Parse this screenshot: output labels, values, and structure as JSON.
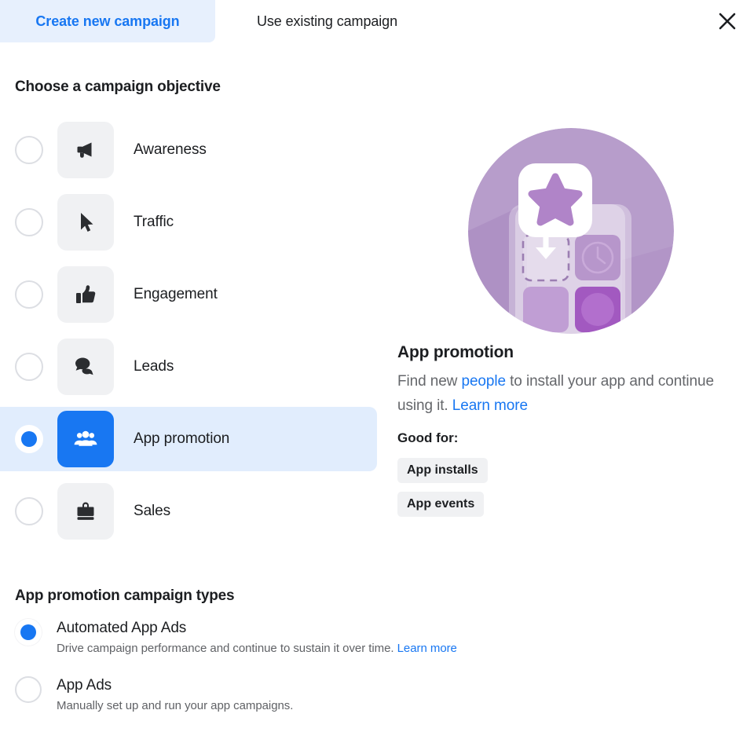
{
  "tabs": [
    {
      "label": "Create new campaign",
      "active": true
    },
    {
      "label": "Use existing campaign",
      "active": false
    }
  ],
  "close_icon": "close-icon",
  "objective_section": {
    "title": "Choose a campaign objective",
    "options": [
      {
        "label": "Awareness",
        "icon": "megaphone-icon",
        "selected": false
      },
      {
        "label": "Traffic",
        "icon": "cursor-icon",
        "selected": false
      },
      {
        "label": "Engagement",
        "icon": "thumbs-up-icon",
        "selected": false
      },
      {
        "label": "Leads",
        "icon": "chat-bubble-icon",
        "selected": false
      },
      {
        "label": "App promotion",
        "icon": "people-icon",
        "selected": true
      },
      {
        "label": "Sales",
        "icon": "briefcase-icon",
        "selected": false
      }
    ]
  },
  "detail": {
    "illustration": "app-install-illustration",
    "title": "App promotion",
    "description_part1": "Find new ",
    "description_link1": "people",
    "description_part2": " to install your app and continue using it. ",
    "description_link2": "Learn more",
    "good_for_label": "Good for:",
    "chips": [
      "App installs",
      "App events"
    ]
  },
  "campaign_types": {
    "title": "App promotion campaign types",
    "options": [
      {
        "label": "Automated App Ads",
        "description": "Drive campaign performance and continue to sustain it over time.",
        "link": "Learn more",
        "selected": true
      },
      {
        "label": "App Ads",
        "description": "Manually set up and run your app campaigns.",
        "link": "",
        "selected": false
      }
    ]
  },
  "colors": {
    "accent_blue": "#1877f2",
    "selected_row_bg": "#e1edfd",
    "tab_active_bg": "#e7f0fd",
    "tile_gray": "#f0f1f3",
    "text_primary": "#1c1e21",
    "text_secondary": "#65676b",
    "illustration_purple": "#b49ac8"
  }
}
